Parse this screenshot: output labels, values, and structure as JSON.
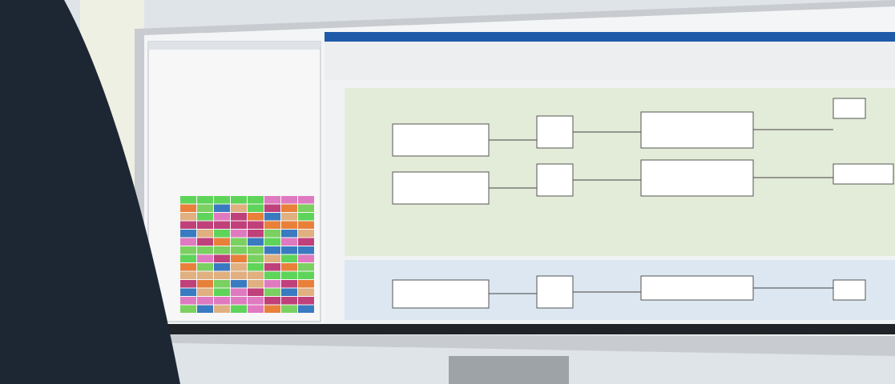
{
  "photo": {
    "kind": "monitor-scene"
  }
}
